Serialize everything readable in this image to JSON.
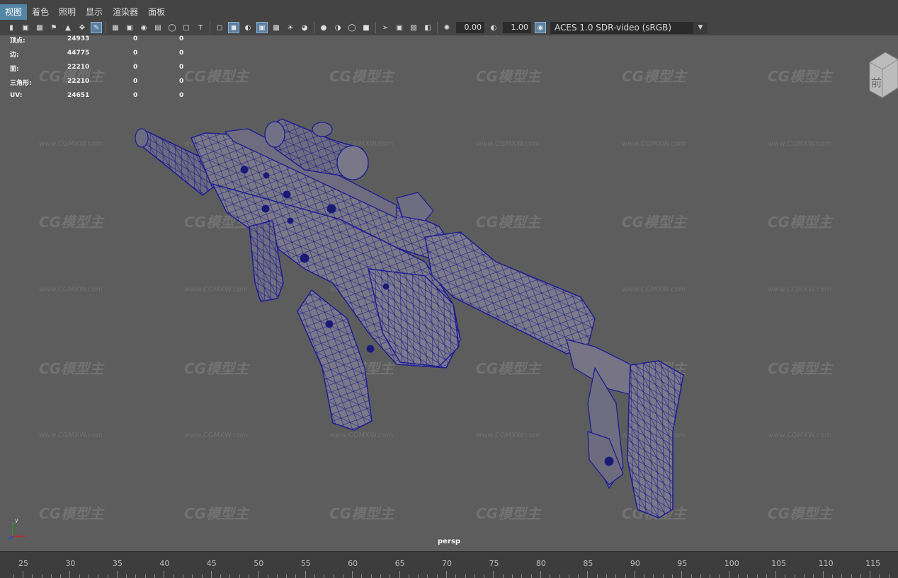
{
  "menu": [
    "视图",
    "着色",
    "照明",
    "显示",
    "渲染器",
    "面板"
  ],
  "toolbar": {
    "exposure": "0.00",
    "gamma": "1.00",
    "color_space": "ACES 1.0 SDR-video (sRGB)"
  },
  "hud": [
    {
      "label": "顶点:",
      "v1": "24933",
      "v2": "0",
      "v3": "0"
    },
    {
      "label": "边:",
      "v1": "44775",
      "v2": "0",
      "v3": "0"
    },
    {
      "label": "面:",
      "v1": "22210",
      "v2": "0",
      "v3": "0"
    },
    {
      "label": "三角形:",
      "v1": "22210",
      "v2": "0",
      "v3": "0"
    },
    {
      "label": "UV:",
      "v1": "24651",
      "v2": "0",
      "v3": "0"
    }
  ],
  "viewcube": {
    "face_label": "前"
  },
  "camera": "persp",
  "watermark": {
    "logo": "CG模型主",
    "url": "www.CGMXW.com"
  },
  "timeline_ticks": [
    "25",
    "30",
    "35",
    "40",
    "45",
    "50",
    "55",
    "60",
    "65",
    "70",
    "75",
    "80",
    "85",
    "90",
    "95",
    "100",
    "105",
    "110",
    "115"
  ],
  "colors": {
    "wire": "#1a1a8c",
    "accent": "#5285a6",
    "background": "#5d5d5d"
  }
}
